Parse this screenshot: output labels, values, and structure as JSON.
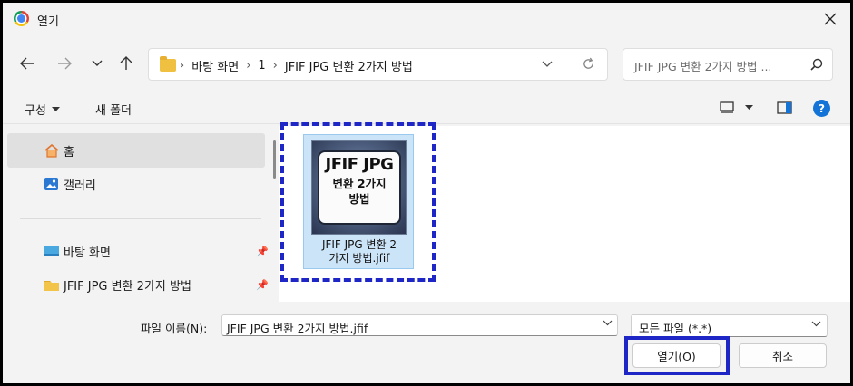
{
  "window": {
    "title": "열기",
    "icon": "chrome-icon"
  },
  "nav": {
    "breadcrumbs": [
      "바탕 화면",
      "1",
      "JFIF JPG 변환 2가지 방법"
    ],
    "search_placeholder": "JFIF JPG 변환 2가지 방법 ..."
  },
  "toolbar": {
    "organize_label": "구성",
    "new_folder_label": "새 폴더"
  },
  "sidebar": {
    "items": [
      {
        "label": "홈",
        "icon": "home-icon",
        "selected": true
      },
      {
        "label": "갤러리",
        "icon": "gallery-icon",
        "selected": false
      },
      {
        "label": "바탕 화면",
        "icon": "desktop-icon",
        "pinned": true
      },
      {
        "label": "JFIF JPG 변환 2가지 방법",
        "icon": "folder-icon",
        "pinned": true
      }
    ]
  },
  "files": [
    {
      "name": "JFIF JPG 변환 2가지 방법.jfif",
      "name_line1": "JFIF JPG 변환 2",
      "name_line2": "가지 방법.jfif",
      "thumbnail": {
        "line1": "JFIF JPG",
        "line2": "변환 2가지",
        "line3": "방법"
      }
    }
  ],
  "footer": {
    "filename_label": "파일 이름(N):",
    "filename_value": "JFIF JPG 변환 2가지 방법.jfif",
    "filetype_value": "모든 파일 (*.*)",
    "open_label": "열기(O)",
    "cancel_label": "취소"
  },
  "colors": {
    "highlight": "#1f26c6",
    "selection": "#cce4f7",
    "help": "#1473d7"
  }
}
